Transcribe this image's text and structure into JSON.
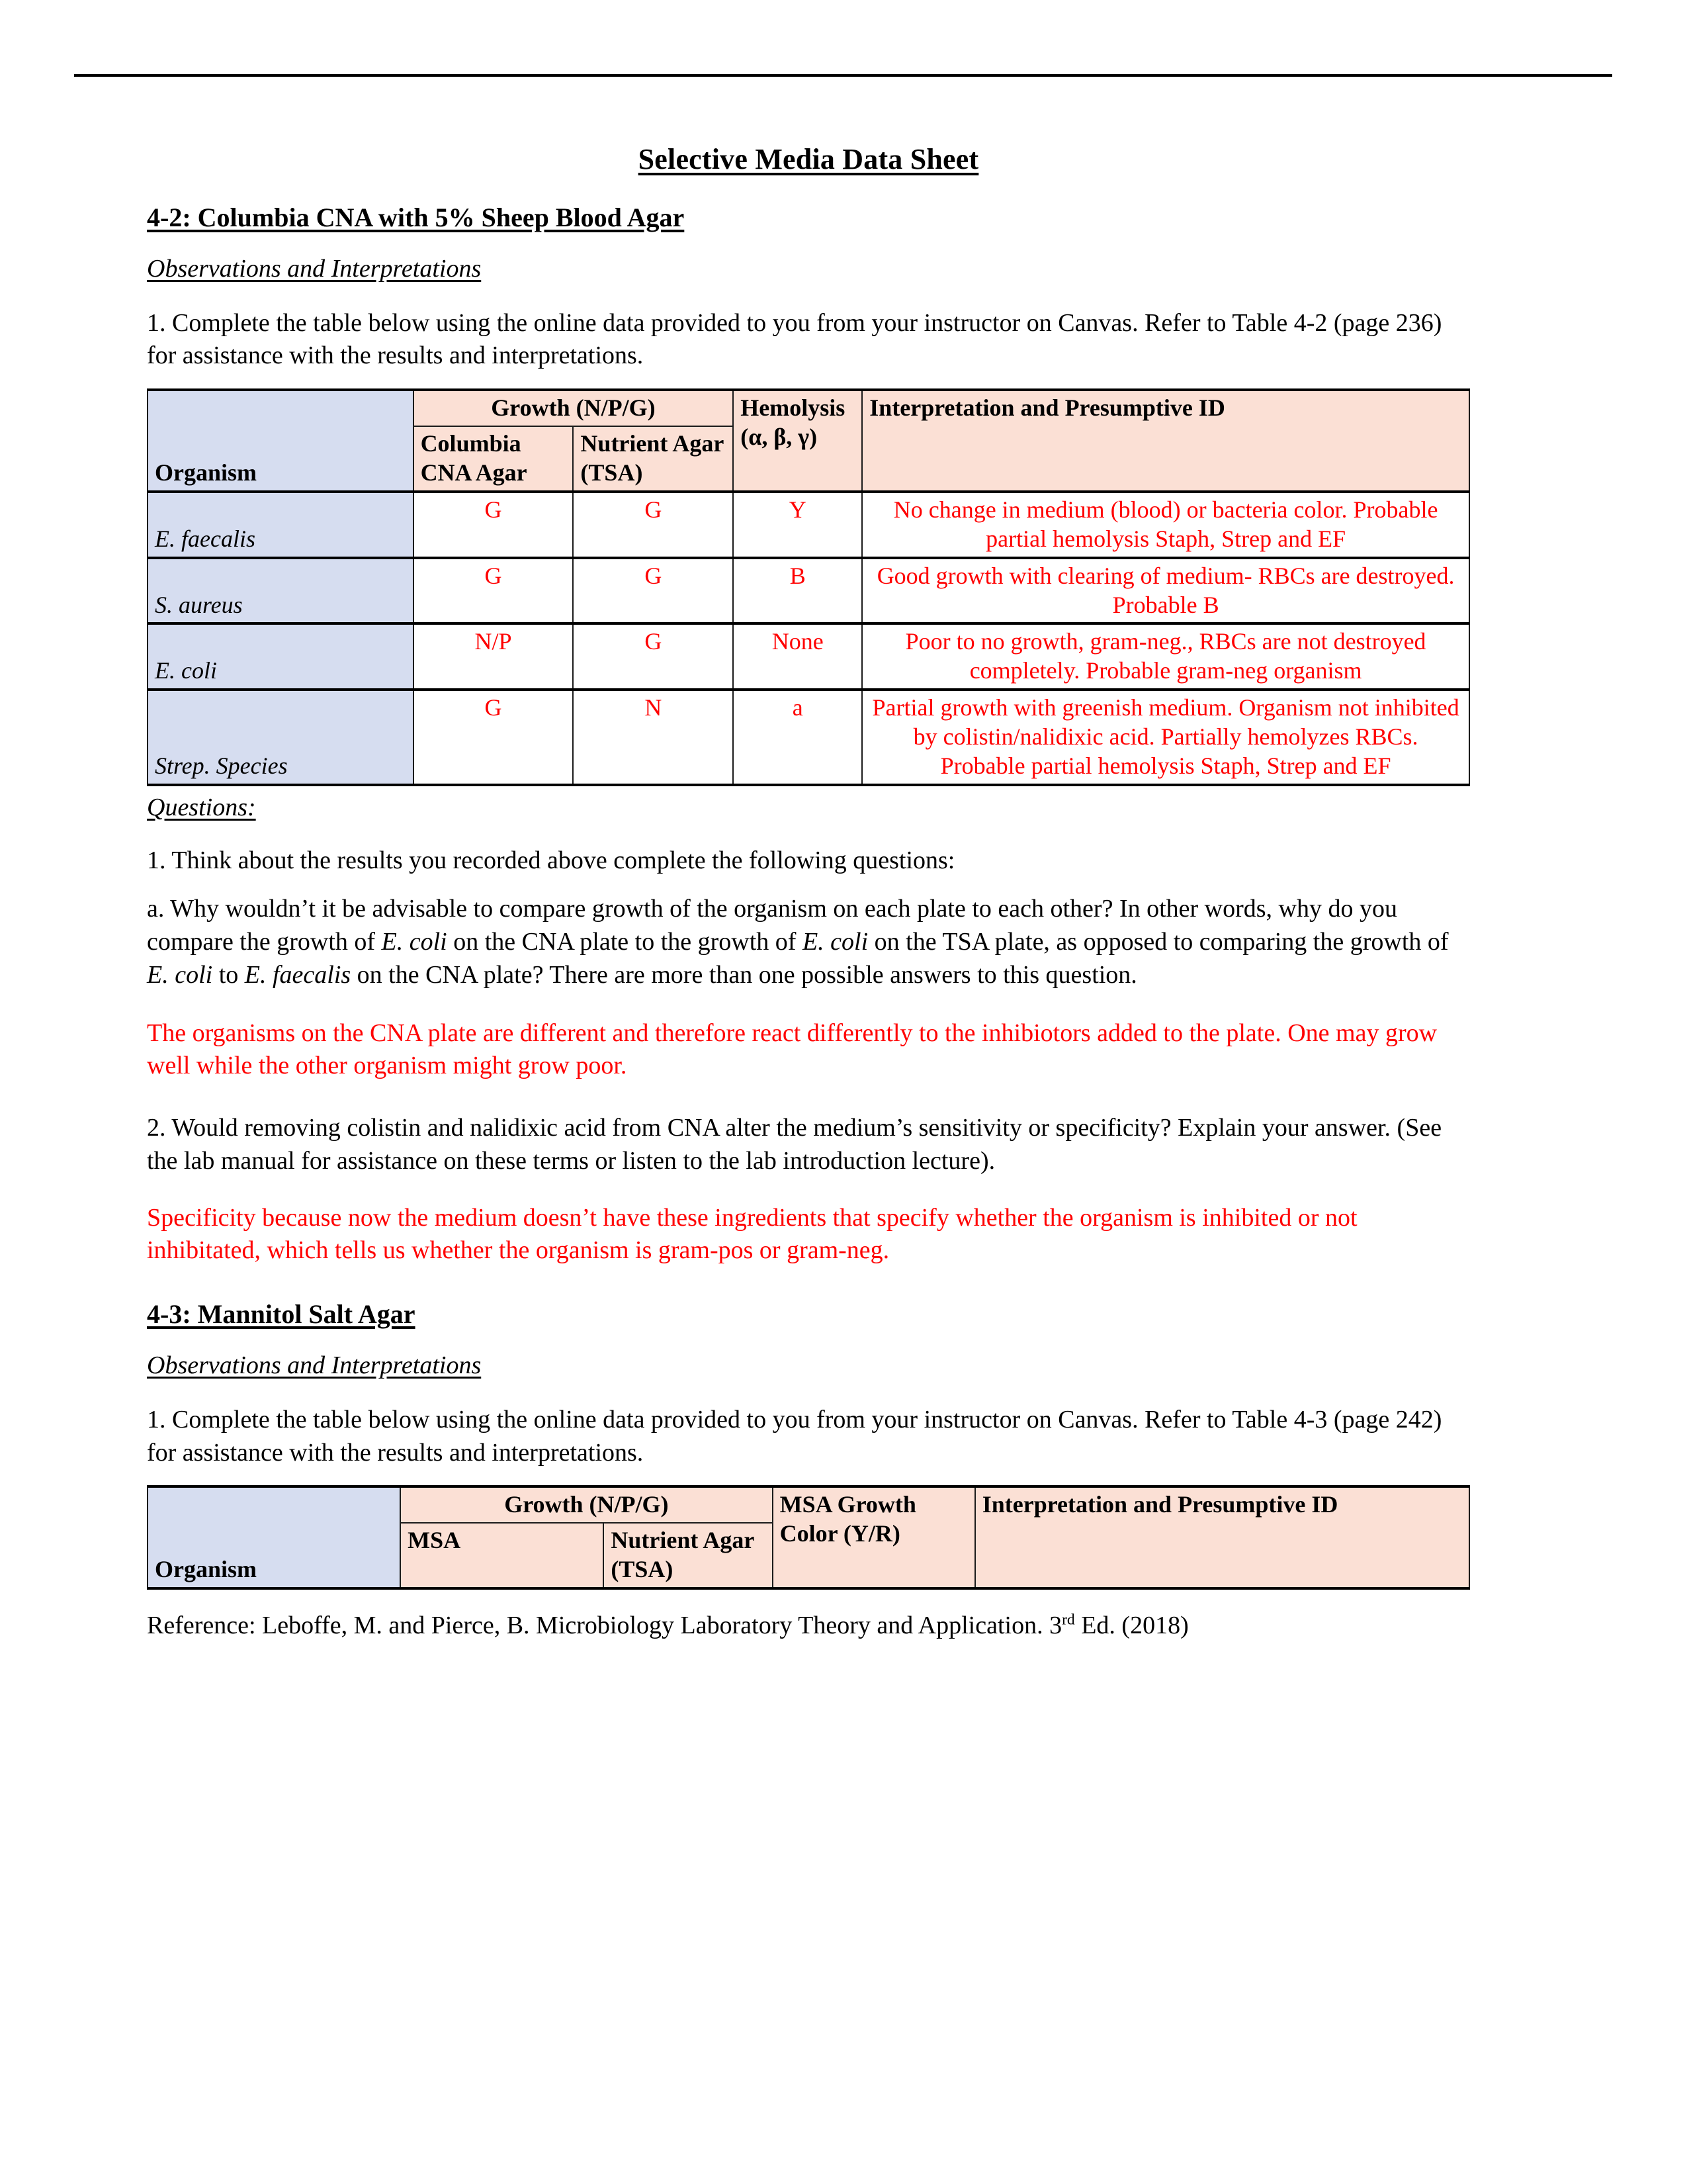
{
  "document": {
    "title": "Selective Media Data Sheet"
  },
  "section_42": {
    "heading": "4-2: Columbia CNA with 5% Sheep Blood Agar",
    "subhead": "Observations and Interpretations ",
    "instruction": "1. Complete the table below using the online data provided to you from your instructor on Canvas. Refer to Table 4-2 (page 236) for assistance with the results and interpretations.",
    "table": {
      "header": {
        "organism": "Organism",
        "growth_group": "Growth (N/P/G)",
        "col_columbia": "Columbia CNA Agar",
        "col_nutrient": "Nutrient Agar (TSA)",
        "col_hemolysis": "Hemolysis (α, β, γ)",
        "col_interpretation": "Interpretation and Presumptive ID"
      },
      "rows": [
        {
          "organism": "E. faecalis",
          "columbia": "G",
          "nutrient": "G",
          "hemolysis": "Y",
          "interpretation": "No change in medium (blood) or bacteria color. Probable partial hemolysis Staph, Strep and EF"
        },
        {
          "organism": "S. aureus",
          "columbia": "G",
          "nutrient": "G",
          "hemolysis": "B",
          "interpretation": "Good growth with clearing of medium- RBCs are destroyed. Probable B"
        },
        {
          "organism": "E. coli",
          "columbia": "N/P",
          "nutrient": "G",
          "hemolysis": "None",
          "interpretation": "Poor to no growth, gram-neg., RBCs are not destroyed completely. Probable gram-neg organism"
        },
        {
          "organism": "Strep. Species",
          "columbia": "G",
          "nutrient": "N",
          "hemolysis": "a",
          "interpretation": "Partial growth with greenish medium. Organism not inhibited by colistin/nalidixic acid. Partially hemolyzes RBCs. Probable partial hemolysis Staph, Strep and EF"
        }
      ]
    },
    "questions_label": "Questions: ",
    "q1_stem": "1. Think about the results you recorded above complete the following questions:",
    "q1a_part1": "a. Why wouldn’t it be advisable to compare growth of the organism on each plate to each other? In other words, why do you compare the growth of ",
    "q1a_italic1": "E. coli",
    "q1a_part2": " on the CNA plate to the growth of ",
    "q1a_italic2": "E. coli",
    "q1a_part3": " on the TSA plate, as opposed to comparing the growth of ",
    "q1a_italic3": "E. coli",
    "q1a_part4": " to ",
    "q1a_italic4": "E. faecalis",
    "q1a_part5": " on the CNA plate? There are more than one possible answers to this question.",
    "q1a_answer": "The organisms on the CNA plate are different and therefore react differently to the inhibiotors added to the plate. One may grow well while the other organism might grow poor.",
    "q2_stem": "2.  Would removing colistin and nalidixic acid from CNA alter the medium’s sensitivity or specificity? Explain your answer.  (See the lab manual for assistance on these terms or listen to the lab introduction lecture).",
    "q2_answer": "Specificity because now the medium doesn’t have these ingredients that specify whether the organism is inhibited or not inhibitated, which tells us whether the organism is gram-pos or gram-neg."
  },
  "section_43": {
    "heading": "4-3: Mannitol Salt Agar",
    "subhead": "Observations and Interpretations ",
    "instruction": "1. Complete the table below using the online data provided to you from your instructor on Canvas. Refer to Table 4-3 (page 242) for assistance with the results and interpretations.",
    "table": {
      "header": {
        "organism": "Organism",
        "growth_group": "Growth (N/P/G)",
        "col_msa": "MSA",
        "col_nutrient": "Nutrient Agar (TSA)",
        "col_msa_color": "MSA Growth Color (Y/R)",
        "col_interpretation": "Interpretation and Presumptive ID"
      },
      "rows": []
    }
  },
  "footer": {
    "reference_part1": "Reference: Leboffe, M. and Pierce, B. Microbiology Laboratory Theory and Application. 3",
    "reference_sup": "rd",
    "reference_part2": " Ed. (2018)"
  }
}
